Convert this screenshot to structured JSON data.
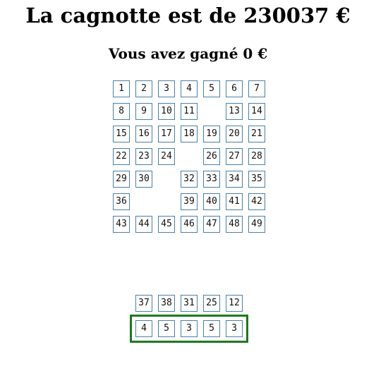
{
  "header": {
    "jackpot_text": "La cagnotte est de 230037 €",
    "winnings_text": "Vous avez gagné 0 €"
  },
  "grid": {
    "rows": [
      [
        "1",
        "2",
        "3",
        "4",
        "5",
        "6",
        "7"
      ],
      [
        "8",
        "9",
        "10",
        "11",
        "",
        "13",
        "14"
      ],
      [
        "15",
        "16",
        "17",
        "18",
        "19",
        "20",
        "21"
      ],
      [
        "22",
        "23",
        "24",
        "",
        "26",
        "27",
        "28"
      ],
      [
        "29",
        "30",
        "",
        "32",
        "33",
        "34",
        "35"
      ],
      [
        "36",
        "",
        "",
        "39",
        "40",
        "41",
        "42"
      ],
      [
        "43",
        "44",
        "45",
        "46",
        "47",
        "48",
        "49"
      ]
    ]
  },
  "drawn_numbers": [
    "37",
    "38",
    "31",
    "25",
    "12"
  ],
  "picked_numbers": [
    "4",
    "5",
    "3",
    "5",
    "3"
  ],
  "colors": {
    "cell_border": "#4a7fa8",
    "picks_border": "#1a7a1a"
  }
}
